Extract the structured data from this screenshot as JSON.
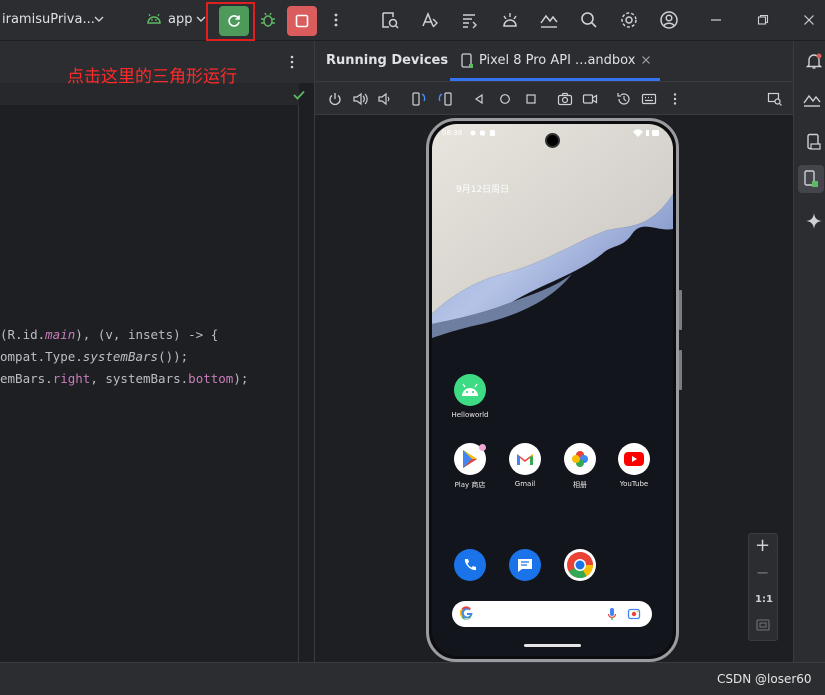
{
  "toolbar": {
    "project_label": "iramisuPriva...",
    "run_config_label": "app",
    "chevron": "chevron-down-icon",
    "colors": {
      "run_green": "#4e9a5b",
      "stop_red": "#db5c5c",
      "highlight_box": "#e02020"
    }
  },
  "annotation": {
    "text": "点击这里的三角形运行",
    "color": "#ff2a2a"
  },
  "editor": {
    "code_lines": [
      {
        "pre": "(R.id.",
        "it": "main",
        "post": "), (v, insets) -> {"
      },
      {
        "pre": "ompat.Type.",
        "it": "systemBars",
        "post": "());"
      },
      {
        "pre": "emBars.",
        "f1": "right",
        "mid": ", systemBars.",
        "f2": "bottom",
        "post": ");"
      }
    ]
  },
  "running_devices": {
    "title": "Running Devices",
    "device_tab": "Pixel 8 Pro API ...andbox"
  },
  "phone": {
    "status_time": "08:38",
    "date": "9月12日周日",
    "apps": [
      {
        "label": "Helloworld"
      },
      {
        "label": "Play 商店"
      },
      {
        "label": "Gmail"
      },
      {
        "label": "相册"
      },
      {
        "label": "YouTube"
      }
    ]
  },
  "zoom": {
    "plus": "+",
    "minus": "−",
    "one_to_one": "1:1"
  },
  "watermark": "CSDN @loser60"
}
